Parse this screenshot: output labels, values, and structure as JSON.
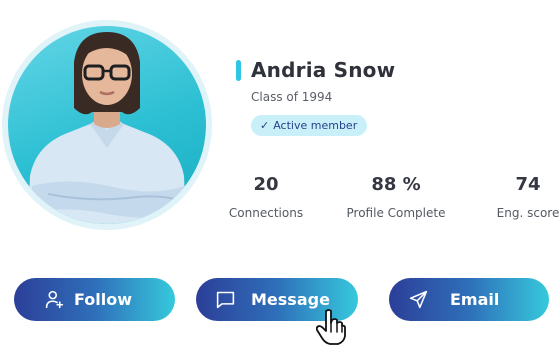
{
  "profile": {
    "name": "Andria Snow",
    "subtitle": "Class of 1994",
    "badge": {
      "icon": "✓",
      "label": "Active member"
    }
  },
  "stats": [
    {
      "value": "20",
      "label": "Connections"
    },
    {
      "value": "88 %",
      "label": "Profile Complete"
    },
    {
      "value": "74",
      "label": "Eng. score"
    }
  ],
  "actions": [
    {
      "label": "Follow",
      "icon": "user-plus-icon"
    },
    {
      "label": "Message",
      "icon": "message-icon"
    },
    {
      "label": "Email",
      "icon": "send-icon"
    }
  ],
  "colors": {
    "accent": "#2fc6e3",
    "button_start": "#2c3f98",
    "button_end": "#36c9dc",
    "badge_bg": "#c9f0f8"
  }
}
